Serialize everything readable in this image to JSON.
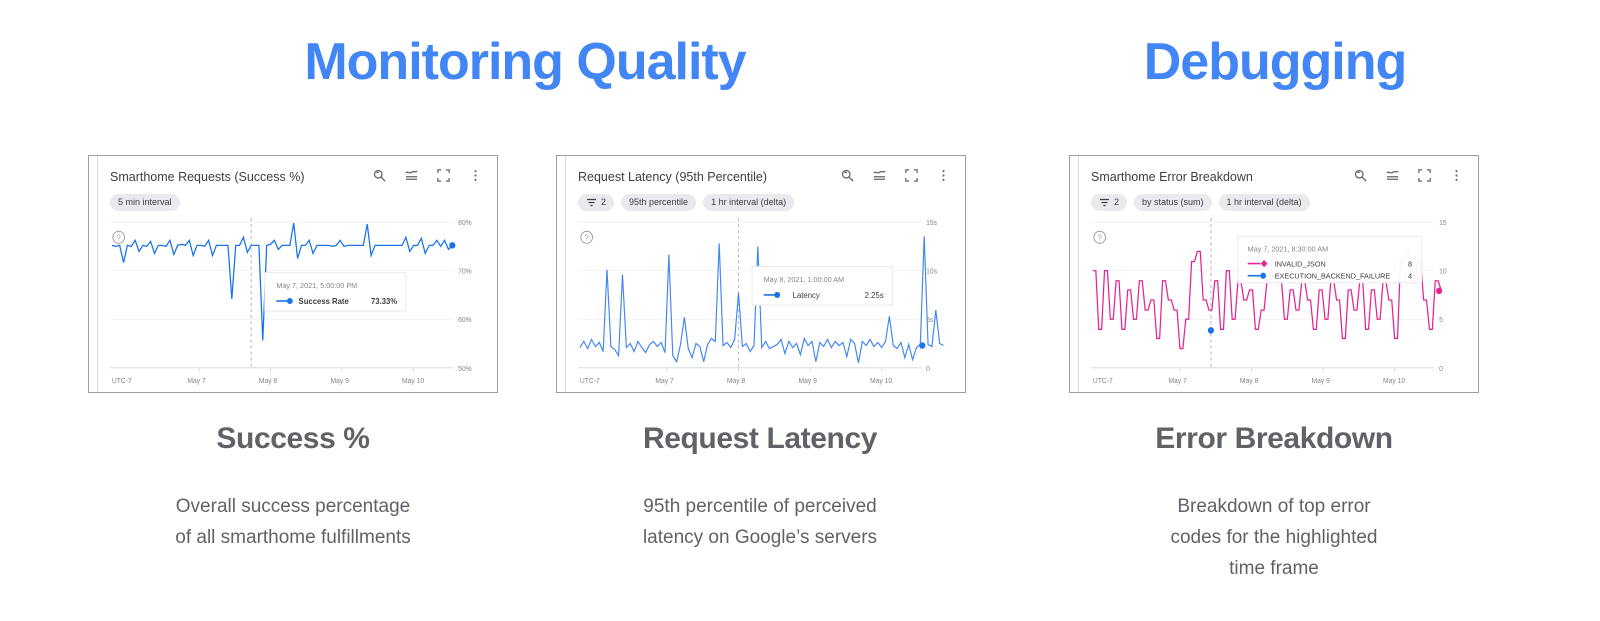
{
  "sections": [
    {
      "title": "Monitoring Quality",
      "color": "#4285f4"
    },
    {
      "title": "Debugging",
      "color": "#4285f4"
    }
  ],
  "cards": [
    {
      "title": "Smarthome Requests (Success %)",
      "chips": [
        {
          "icon": "",
          "label": "5 min interval"
        }
      ],
      "tools": [
        "zoom-icon",
        "chart-style-icon",
        "fullscreen-icon",
        "more-vert-icon"
      ],
      "help_icon": "help-circle-icon",
      "tooltip": {
        "timestamp": "May 7, 2021, 5:00:00 PM",
        "rows": [
          {
            "marker": "#1a73e8",
            "label": "Success Rate",
            "value": "73.33%"
          }
        ]
      }
    },
    {
      "title": "Request Latency (95th Percentile)",
      "chips": [
        {
          "icon": "filter-icon",
          "label": "2"
        },
        {
          "icon": "",
          "label": "95th percentile"
        },
        {
          "icon": "",
          "label": "1 hr interval (delta)"
        }
      ],
      "tools": [
        "zoom-icon",
        "chart-style-icon",
        "fullscreen-icon",
        "more-vert-icon"
      ],
      "help_icon": "help-circle-icon",
      "tooltip": {
        "timestamp": "May 8, 2021, 1:00:00 AM",
        "rows": [
          {
            "marker": "#1a73e8",
            "label": "Latency",
            "value": "2.25s"
          }
        ]
      }
    },
    {
      "title": "Smarthome Error Breakdown",
      "chips": [
        {
          "icon": "filter-icon",
          "label": "2"
        },
        {
          "icon": "",
          "label": "by status (sum)"
        },
        {
          "icon": "",
          "label": "1 hr interval (delta)"
        }
      ],
      "tools": [
        "zoom-icon",
        "chart-style-icon",
        "fullscreen-icon",
        "more-vert-icon"
      ],
      "help_icon": "help-circle-icon",
      "tooltip": {
        "timestamp": "May 7, 2021, 8:30:00 AM",
        "rows": [
          {
            "marker": "#e52592",
            "label": "INVALID_JSON",
            "value": "8"
          },
          {
            "marker": "#1a73e8",
            "label": "EXECUTION_BACKEND_FAILURE",
            "value": "4"
          }
        ]
      }
    }
  ],
  "captions": [
    {
      "title": "Success %",
      "body": "Overall success percentage\nof all smarthome fulfillments"
    },
    {
      "title": "Request Latency",
      "body": "95th percentile of perceived\nlatency on Google’s servers"
    },
    {
      "title": "Error Breakdown",
      "body": "Breakdown of top error\ncodes for the highlighted\ntime frame"
    }
  ],
  "chart_data": [
    {
      "type": "line",
      "title": "Smarthome Requests (Success %)",
      "xlabel": "UTC-7",
      "ylabel": "",
      "ylim": [
        50,
        80
      ],
      "yticks": [
        "50%",
        "60%",
        "70%",
        "80%"
      ],
      "xticks": [
        "UTC-7",
        "May 7",
        "May 8",
        "May 9",
        "May 10"
      ],
      "grid": true,
      "legend": "tooltip",
      "series": [
        {
          "name": "Success Rate",
          "color": "#1a73e8",
          "values": [
            75.2,
            75.1,
            75.3,
            71.6,
            75.3,
            75.2,
            76.4,
            74.2,
            75.3,
            75.1,
            76.0,
            73.8,
            75.2,
            75.3,
            75.1,
            76.1,
            73.6,
            75.2,
            75.4,
            75.2,
            76.2,
            73.5,
            75.2,
            75.3,
            75.1,
            76.3,
            73.4,
            75.2,
            75.3,
            75.2,
            75.3,
            64.8,
            75.2,
            75.3,
            76.6,
            73.9,
            75.2,
            75.3,
            75.2,
            56.6,
            75.2,
            75.4,
            76.2,
            74.4,
            75.3,
            75.2,
            75.3,
            79.8,
            73.3,
            75.2,
            75.3,
            76.4,
            73.8,
            75.2,
            75.3,
            75.2,
            75.3,
            75.1,
            75.3,
            76.1,
            75.0,
            75.3,
            75.2,
            75.3,
            75.2,
            75.3,
            79.7,
            73.5,
            75.2,
            75.3,
            75.2,
            75.3,
            75.2,
            75.3,
            75.2,
            75.3,
            76.6,
            74.2,
            75.3,
            75.2,
            76.5,
            73.8,
            75.3,
            75.2,
            76.4,
            75.0,
            76.3,
            74.4,
            75.2,
            78.4,
            73.1,
            75.6
          ]
        }
      ],
      "annotations": [
        {
          "type": "vline",
          "label": "May 7, 2021, 5:00:00 PM",
          "value": "73.33%"
        }
      ]
    },
    {
      "type": "line",
      "title": "Request Latency (95th Percentile)",
      "xlabel": "UTC-7",
      "ylabel": "",
      "ylim": [
        0,
        15
      ],
      "yticks": [
        "0",
        "5s",
        "10s",
        "15s"
      ],
      "xticks": [
        "UTC-7",
        "May 7",
        "May 8",
        "May 9",
        "May 10"
      ],
      "grid": true,
      "legend": "tooltip",
      "series": [
        {
          "name": "Latency",
          "color": "#4285f4",
          "values": [
            2.0,
            2.6,
            1.9,
            2.8,
            2.1,
            2.5,
            1.6,
            9.6,
            2.1,
            1.8,
            1.2,
            9.1,
            2.0,
            2.4,
            1.6,
            2.6,
            2.0,
            1.5,
            2.3,
            2.6,
            2.1,
            2.5,
            1.5,
            11.1,
            1.2,
            0.6,
            2.3,
            5.0,
            1.9,
            1.0,
            2.4,
            2.1,
            0.6,
            2.3,
            2.9,
            2.6,
            12.3,
            2.2,
            2.5,
            2.0,
            2.8,
            7.4,
            2.1,
            2.4,
            1.6,
            2.2,
            12.0,
            2.0,
            2.6,
            1.9,
            2.1,
            2.3,
            2.8,
            1.4,
            2.6,
            2.0,
            2.4,
            1.3,
            2.9,
            2.2,
            2.6,
            0.6,
            2.5,
            2.1,
            2.8,
            1.9,
            2.6,
            2.2,
            2.5,
            1.1,
            2.9,
            2.4,
            0.5,
            2.6,
            2.2,
            2.8,
            2.1,
            2.5,
            2.0,
            2.6,
            5.1,
            2.2,
            1.9,
            2.5,
            1.0,
            2.3,
            0.8,
            2.0,
            12.9,
            2.3,
            2.1,
            5.8,
            2.3,
            2.2
          ]
        }
      ],
      "annotations": [
        {
          "type": "vline",
          "label": "May 8, 2021, 1:00:00 AM",
          "value": "2.25s"
        }
      ]
    },
    {
      "type": "line",
      "title": "Smarthome Error Breakdown",
      "xlabel": "UTC-7",
      "ylabel": "",
      "ylim": [
        0,
        15
      ],
      "yticks": [
        "0",
        "5",
        "10",
        "15"
      ],
      "xticks": [
        "UTC-7",
        "May 7",
        "May 8",
        "May 9",
        "May 10"
      ],
      "grid": true,
      "legend": "tooltip",
      "series": [
        {
          "name": "INVALID_JSON",
          "color": "#e52592",
          "values": [
            10,
            4,
            10,
            5,
            9,
            4,
            8,
            5,
            9,
            6,
            7,
            3,
            9,
            7,
            6,
            2,
            5,
            11,
            12,
            7,
            5,
            9,
            4,
            6,
            10,
            5,
            9,
            7,
            8,
            4,
            6,
            12,
            9,
            5,
            3,
            7,
            9,
            6,
            4,
            8,
            5,
            9,
            6,
            8,
            5,
            7,
            9,
            6,
            8,
            4,
            7,
            5,
            8,
            3,
            6,
            9,
            7,
            5,
            8,
            6,
            4,
            7,
            9,
            5,
            8,
            6,
            3,
            7,
            5,
            9,
            6,
            8,
            4,
            7,
            5,
            9,
            6,
            8,
            5,
            7,
            3,
            9,
            6,
            8,
            5,
            12,
            9,
            6,
            10,
            7,
            9,
            5,
            4,
            8
          ]
        },
        {
          "name": "EXECUTION_BACKEND_FAILURE",
          "color": "#1a73e8",
          "values": [
            4
          ]
        }
      ],
      "annotations": [
        {
          "type": "vline",
          "label": "May 7, 2021, 8:30:00 AM",
          "values": [
            "8",
            "4"
          ]
        }
      ]
    }
  ]
}
